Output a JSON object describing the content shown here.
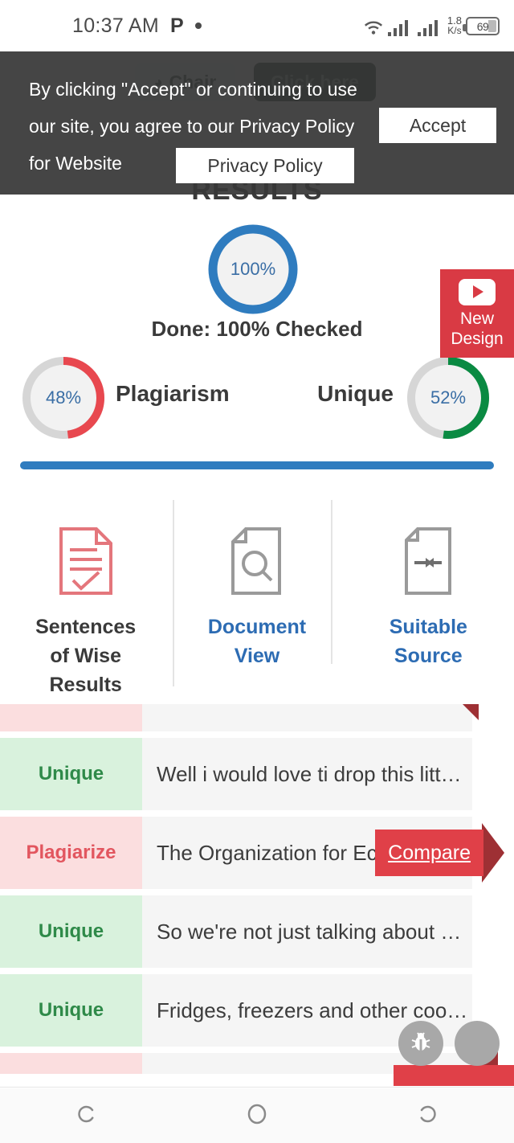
{
  "status_bar": {
    "time": "10:37 AM",
    "app_indicator": "P",
    "dot_indicator": "•",
    "wifi_icon": "wifi-icon",
    "signal_icon_1": "signal-bars-icon",
    "signal_icon_2": "signal-bars-icon",
    "data_rate_value": "1.8",
    "data_rate_unit": "K/s",
    "battery_level": "69"
  },
  "background_page": {
    "chair_button": "Chair",
    "chair_icon": "headphones-icon",
    "click_here_button": "Click here",
    "results_heading": "RESULTS"
  },
  "cookie_banner": {
    "message": "By clicking \"Accept\" or continuing to use our site, you agree to our Privacy Policy for Website",
    "accept_label": "Accept",
    "privacy_label": "Privacy Policy",
    "background_color": "#373737"
  },
  "results": {
    "main_percent": "100%",
    "done_text": "Done: 100% Checked",
    "plagiarism_percent": "48%",
    "plagiarism_label": "Plagiarism",
    "unique_percent": "52%",
    "unique_label": "Unique",
    "progress_bar_color": "#2f7cbf",
    "plagiarism_color": "#e8484f",
    "unique_color": "#0a8a42",
    "main_ring_color": "#2f7cbf"
  },
  "new_design_badge": {
    "line1": "New",
    "line2": "Design",
    "icon": "youtube-icon",
    "color": "#d93a44"
  },
  "tabs": [
    {
      "label_line1": "Sentences",
      "label_line2": "of Wise",
      "label_line3": "Results",
      "icon": "document-check-icon",
      "active": true
    },
    {
      "label_line1": "Document",
      "label_line2": "View",
      "label_line3": "",
      "icon": "document-search-icon",
      "active": false
    },
    {
      "label_line1": "Suitable",
      "label_line2": "Source",
      "label_line3": "",
      "icon": "document-compare-icon",
      "active": false
    }
  ],
  "sentence_rows": [
    {
      "tag": "",
      "text": "",
      "type": "plag",
      "clipped": true,
      "has_compare": false
    },
    {
      "tag": "Unique",
      "text": "Well i would love ti drop this litt…",
      "type": "unique",
      "clipped": false,
      "has_compare": false
    },
    {
      "tag": "Plagiarize",
      "text": "The Organization for Econo…",
      "type": "plag",
      "clipped": false,
      "has_compare": true
    },
    {
      "tag": "Unique",
      "text": "So we're not just talking about …",
      "type": "unique",
      "clipped": false,
      "has_compare": false
    },
    {
      "tag": "Unique",
      "text": "Fridges, freezers and other coo…",
      "type": "unique",
      "clipped": false,
      "has_compare": false
    },
    {
      "tag": "",
      "text": "",
      "type": "plag",
      "clipped": true,
      "has_compare": false
    }
  ],
  "compare_button": {
    "label": "Compare",
    "color": "#e04048"
  },
  "floating_buttons": [
    {
      "icon": "bug-icon",
      "name": "debug-fab"
    },
    {
      "icon": "blank-icon",
      "name": "secondary-fab"
    }
  ],
  "nav_bar": {
    "back_icon": "back-icon",
    "home_icon": "home-icon",
    "recents_icon": "recents-icon"
  }
}
